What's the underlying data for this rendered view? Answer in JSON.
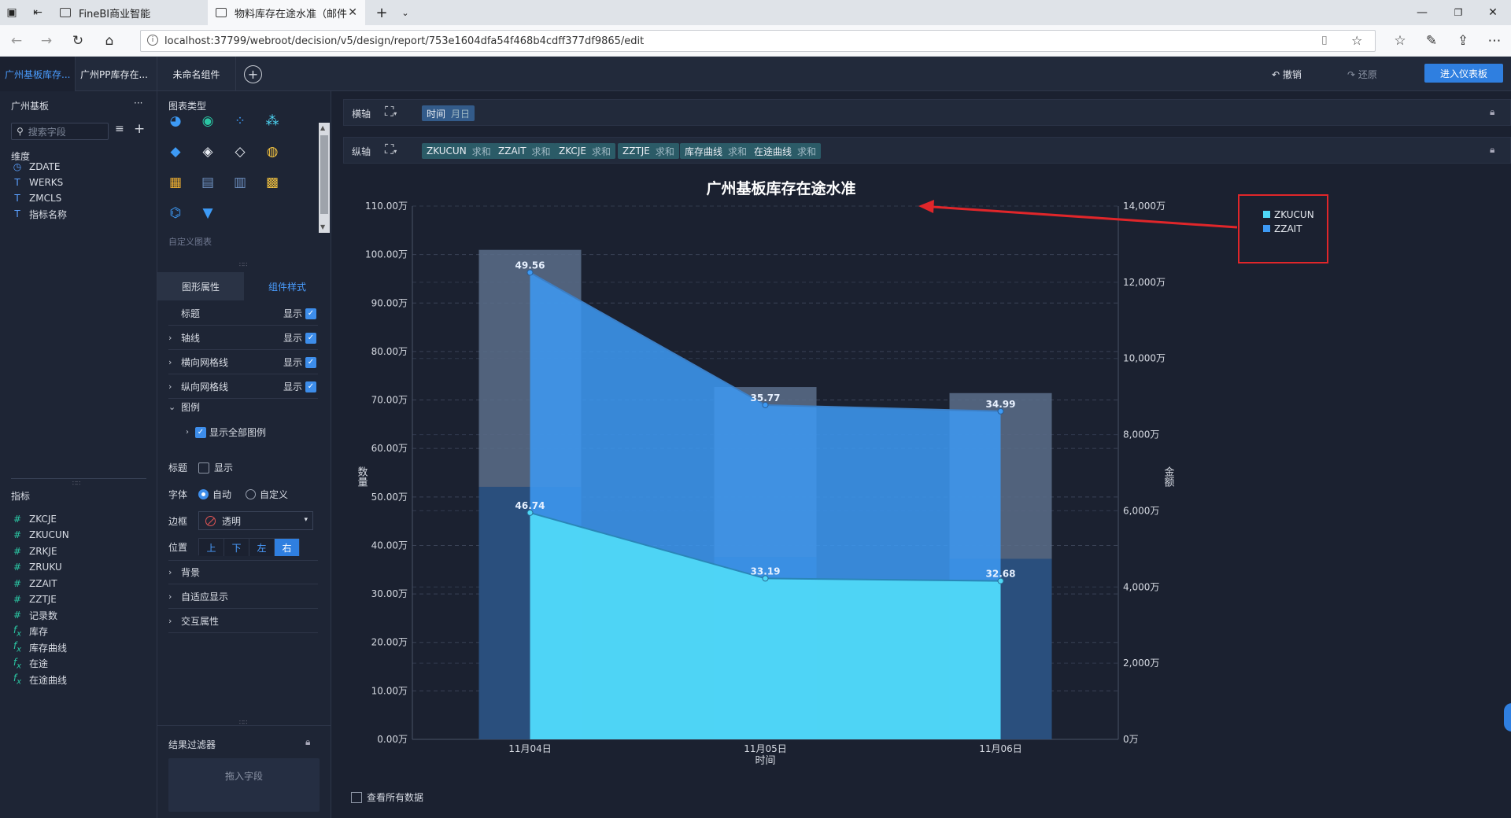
{
  "browser": {
    "tabs": [
      {
        "title": "FineBI商业智能"
      },
      {
        "title": "物料库存在途水准（邮件"
      }
    ],
    "new_tab": "+",
    "url": "localhost:37799/webroot/decision/v5/design/report/753e1604dfa54f468b4cdff377df9865/edit"
  },
  "app": {
    "tabs": [
      "广州基板库存...",
      "广州PP库存在...",
      "未命名组件"
    ],
    "undo": "撤销",
    "redo": "还原",
    "enter_dashboard": "进入仪表板"
  },
  "left_panel": {
    "dataset_name": "广州基板",
    "more": "···",
    "search_placeholder": "搜索字段",
    "dimension_title": "维度",
    "dimensions": [
      {
        "name": "ZDATE",
        "icon": "clock-icon"
      },
      {
        "name": "WERKS",
        "icon": "text-field-icon"
      },
      {
        "name": "ZMCLS",
        "icon": "text-field-icon"
      },
      {
        "name": "指标名称",
        "icon": "text-field-icon"
      }
    ],
    "measure_title": "指标",
    "measures": [
      {
        "name": "ZKCJE",
        "icon": "hash-icon"
      },
      {
        "name": "ZKUCUN",
        "icon": "hash-icon"
      },
      {
        "name": "ZRKJE",
        "icon": "hash-icon"
      },
      {
        "name": "ZRUKU",
        "icon": "hash-icon"
      },
      {
        "name": "ZZAIT",
        "icon": "hash-icon"
      },
      {
        "name": "ZZTJE",
        "icon": "hash-icon"
      },
      {
        "name": "记录数",
        "icon": "hash-icon"
      },
      {
        "name": "库存",
        "icon": "fx-icon"
      },
      {
        "name": "库存曲线",
        "icon": "fx-icon"
      },
      {
        "name": "在途",
        "icon": "fx-icon"
      },
      {
        "name": "在途曲线",
        "icon": "fx-icon"
      }
    ]
  },
  "mid_panel": {
    "chart_type_title": "图表类型",
    "custom_chart": "自定义图表",
    "tabs": [
      "图形属性",
      "组件样式"
    ],
    "properties": [
      {
        "label": "标题",
        "show": "显示",
        "expandable": false
      },
      {
        "label": "轴线",
        "show": "显示",
        "expandable": true
      },
      {
        "label": "横向网格线",
        "show": "显示",
        "expandable": true
      },
      {
        "label": "纵向网格线",
        "show": "显示",
        "expandable": true
      }
    ],
    "legend_label": "图例",
    "show_all_legend": "显示全部图例",
    "legend_title_label": "标题",
    "legend_title_show": "显示",
    "font_label": "字体",
    "font_auto": "自动",
    "font_custom": "自定义",
    "border_label": "边框",
    "border_value": "透明",
    "position_label": "位置",
    "positions": [
      "上",
      "下",
      "左",
      "右"
    ],
    "position_selected": "右",
    "sections": [
      "背景",
      "自适应显示",
      "交互属性"
    ],
    "result_filter": "结果过滤器",
    "drop_field": "拖入字段"
  },
  "axes": {
    "x_label": "横轴",
    "x_pills": [
      {
        "name": "时间",
        "agg": "月日"
      }
    ],
    "y_label": "纵轴",
    "y_pills": [
      {
        "name": "ZKUCUN",
        "agg": "求和"
      },
      {
        "name": "ZZAIT",
        "agg": "求和"
      },
      {
        "name": "ZKCJE",
        "agg": "求和"
      },
      {
        "name": "ZZTJE",
        "agg": "求和"
      },
      {
        "name": "库存曲线",
        "agg": "求和"
      },
      {
        "name": "在途曲线",
        "agg": "求和"
      }
    ]
  },
  "view_all_data": "查看所有数据",
  "chart_data": {
    "type": "bar",
    "title": "广州基板库存在途水准",
    "xlabel": "时间",
    "ylabel": "数量",
    "y2label": "金额",
    "categories": [
      "11月04日",
      "11月05日",
      "11月06日"
    ],
    "ylim": [
      0,
      110
    ],
    "y_ticks": [
      "0.00万",
      "10.00万",
      "20.00万",
      "30.00万",
      "40.00万",
      "50.00万",
      "60.00万",
      "70.00万",
      "80.00万",
      "90.00万",
      "100.00万",
      "110.00万"
    ],
    "y2lim": [
      0,
      14000
    ],
    "y2_ticks": [
      "0万",
      "2,000万",
      "4,000万",
      "6,000万",
      "8,000万",
      "10,000万",
      "12,000万",
      "14,000万"
    ],
    "legend_position": "top-right",
    "grid": true,
    "series": [
      {
        "name": "ZKUCUN",
        "kind": "area-stacked",
        "axis": "left",
        "values": [
          46.74,
          33.19,
          32.68
        ],
        "color": "#4fd8f7"
      },
      {
        "name": "ZZAIT",
        "kind": "area-stacked",
        "axis": "left",
        "values": [
          49.56,
          35.77,
          34.99
        ],
        "color": "#3d9af5"
      },
      {
        "kind": "bar",
        "axis": "right",
        "values": [
          6630,
          4790,
          4740
        ],
        "color": "#2a4f7d"
      },
      {
        "kind": "bar",
        "axis": "right",
        "values": [
          12850,
          9250,
          9090
        ],
        "color": "#5b6d8a"
      }
    ],
    "data_labels": [
      "46.74",
      "33.19",
      "32.68",
      "49.56",
      "35.77",
      "34.99"
    ]
  },
  "colors": {
    "accent": "#2f7fe0",
    "panel": "#1e2535",
    "background": "#1b2130",
    "highlight_box": "#e0262a"
  }
}
